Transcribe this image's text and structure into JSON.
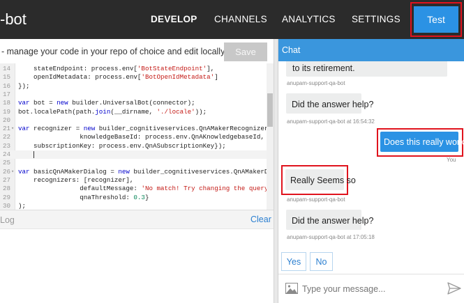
{
  "app": {
    "brand": "-bot"
  },
  "nav": {
    "tabs": [
      {
        "label": "DEVELOP",
        "active": true
      },
      {
        "label": "CHANNELS",
        "active": false
      },
      {
        "label": "ANALYTICS",
        "active": false
      },
      {
        "label": "SETTINGS",
        "active": false
      }
    ],
    "test_label": "Test"
  },
  "editor": {
    "description": "- manage your code in your repo of choice and edit locally.",
    "save_label": "Save",
    "lines": [
      {
        "n": "14",
        "parts": [
          [
            "",
            "    stateEndpoint: process.env["
          ],
          [
            "str",
            "'BotStateEndpoint'"
          ],
          [
            "",
            "],"
          ]
        ]
      },
      {
        "n": "15",
        "parts": [
          [
            "",
            "    openIdMetadata: process.env["
          ],
          [
            "str",
            "'BotOpenIdMetadata'"
          ],
          [
            "",
            "]"
          ]
        ]
      },
      {
        "n": "16",
        "parts": [
          [
            "",
            "});"
          ]
        ]
      },
      {
        "n": "17",
        "parts": []
      },
      {
        "n": "18",
        "parts": [
          [
            "kw",
            "var"
          ],
          [
            "",
            " bot = "
          ],
          [
            "kw",
            "new"
          ],
          [
            "",
            " builder.UniversalBot(connector);"
          ]
        ]
      },
      {
        "n": "19",
        "parts": [
          [
            "",
            "bot.localePath(path."
          ],
          [
            "kw",
            "join"
          ],
          [
            "",
            "(__dirname, "
          ],
          [
            "str",
            "'./locale'"
          ],
          [
            "",
            "));"
          ]
        ]
      },
      {
        "n": "20",
        "parts": []
      },
      {
        "n": "21",
        "fold": true,
        "parts": [
          [
            "kw",
            "var"
          ],
          [
            "",
            " recognizer = "
          ],
          [
            "kw",
            "new"
          ],
          [
            "",
            " builder_cognitiveservices.QnAMakerRecognizer({"
          ]
        ]
      },
      {
        "n": "22",
        "parts": [
          [
            "",
            "                knowledgeBaseId: process.env.QnAKnowledgebaseId,"
          ]
        ]
      },
      {
        "n": "23",
        "parts": [
          [
            "",
            "    subscriptionKey: process.env.QnASubscriptionKey});"
          ]
        ]
      },
      {
        "n": "24",
        "current": true,
        "parts": [
          [
            "",
            "    "
          ]
        ]
      },
      {
        "n": "25",
        "parts": []
      },
      {
        "n": "26",
        "fold": true,
        "parts": [
          [
            "kw",
            "var"
          ],
          [
            "",
            " basicQnAMakerDialog = "
          ],
          [
            "kw",
            "new"
          ],
          [
            "",
            " builder_cognitiveservices.QnAMakerDialog({"
          ]
        ]
      },
      {
        "n": "27",
        "parts": [
          [
            "",
            "    recognizers: [recognizer],"
          ]
        ]
      },
      {
        "n": "28",
        "parts": [
          [
            "",
            "                defaultMessage: "
          ],
          [
            "str",
            "'No match! Try changing the query terms!'"
          ],
          [
            "",
            ","
          ]
        ]
      },
      {
        "n": "29",
        "parts": [
          [
            "",
            "                qnaThreshold: "
          ],
          [
            "num",
            "0.3"
          ],
          [
            "",
            "}"
          ]
        ]
      },
      {
        "n": "30",
        "parts": [
          [
            "",
            ");"
          ]
        ]
      }
    ]
  },
  "log": {
    "title": "Log",
    "clear_label": "Clear"
  },
  "chat": {
    "title": "Chat",
    "messages": {
      "retirement_text": "to its retirement.",
      "retirement_meta": "anupam-support-qa-bot",
      "answer_help_1": "Did the answer help?",
      "answer_help_1_meta": "anupam-support-qa-bot at 16:54:32",
      "user_question": "Does this really work?",
      "user_meta": "You",
      "seems_so": "Really Seems so",
      "seems_so_meta": "anupam-support-qa-bot",
      "answer_help_2": "Did the answer help?",
      "answer_help_2_meta": "anupam-support-qa-bot at 17:05:18"
    },
    "actions": {
      "yes": "Yes",
      "no": "No"
    },
    "input_placeholder": "Type your message..."
  },
  "colors": {
    "nav_background": "#2b2b2b",
    "accent_blue": "#2b92e4",
    "chat_header": "#3a96dd",
    "highlight_red": "#e0131d",
    "bot_bubble": "#eceded"
  },
  "icons": {
    "attach": "image-icon",
    "send": "send-icon"
  }
}
